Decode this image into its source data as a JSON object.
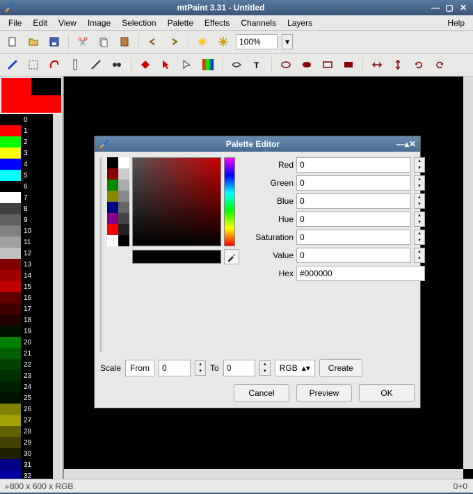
{
  "window": {
    "title": "mtPaint 3.31 - Untitled"
  },
  "menu": {
    "file": "File",
    "edit": "Edit",
    "view": "View",
    "image": "Image",
    "selection": "Selection",
    "palette": "Palette",
    "effects": "Effects",
    "channels": "Channels",
    "layers": "Layers",
    "help": "Help"
  },
  "toolbar": {
    "zoom": "100%"
  },
  "status": {
    "left": "800 x 600 x RGB",
    "right": "0+0"
  },
  "palette_left": [
    {
      "i": 0,
      "c": "#000000"
    },
    {
      "i": 1,
      "c": "#ff0000"
    },
    {
      "i": 2,
      "c": "#00ff00"
    },
    {
      "i": 3,
      "c": "#ffff00"
    },
    {
      "i": 4,
      "c": "#0000ff"
    },
    {
      "i": 5,
      "c": "#00ffff"
    },
    {
      "i": 6,
      "c": "#000000"
    },
    {
      "i": 7,
      "c": "#ffffff"
    },
    {
      "i": 8,
      "c": "#404040"
    },
    {
      "i": 9,
      "c": "#606060"
    },
    {
      "i": 10,
      "c": "#808080"
    },
    {
      "i": 11,
      "c": "#a0a0a0"
    },
    {
      "i": 12,
      "c": "#c0c0c0"
    },
    {
      "i": 13,
      "c": "#800000"
    },
    {
      "i": 14,
      "c": "#a00000"
    },
    {
      "i": 15,
      "c": "#c00000"
    },
    {
      "i": 16,
      "c": "#600000"
    },
    {
      "i": 17,
      "c": "#400000"
    },
    {
      "i": 18,
      "c": "#200000"
    },
    {
      "i": 19,
      "c": "#001000"
    },
    {
      "i": 20,
      "c": "#008000"
    },
    {
      "i": 21,
      "c": "#006000"
    },
    {
      "i": 22,
      "c": "#004000"
    },
    {
      "i": 23,
      "c": "#003000"
    },
    {
      "i": 24,
      "c": "#002000"
    },
    {
      "i": 25,
      "c": "#001000"
    },
    {
      "i": 26,
      "c": "#808000"
    },
    {
      "i": 27,
      "c": "#a0a000"
    },
    {
      "i": 28,
      "c": "#606000"
    },
    {
      "i": 29,
      "c": "#404000"
    },
    {
      "i": 30,
      "c": "#202000"
    },
    {
      "i": 31,
      "c": "#000080"
    },
    {
      "i": 32,
      "c": "#0000a0"
    }
  ],
  "dialog": {
    "title": "Palette Editor",
    "palette": [
      {
        "i": 0,
        "c": "#000000"
      },
      {
        "i": 1,
        "c": "#ff0000"
      },
      {
        "i": 2,
        "c": "#00ff00"
      },
      {
        "i": 3,
        "c": "#ffff00"
      },
      {
        "i": 4,
        "c": "#0000ff"
      },
      {
        "i": 5,
        "c": "#ff00ff"
      },
      {
        "i": 6,
        "c": "#00ffff"
      },
      {
        "i": 7,
        "c": "#ffffff"
      },
      {
        "i": 8,
        "c": "#c0c0c0"
      },
      {
        "i": 9,
        "c": "#a0a0a0"
      },
      {
        "i": 10,
        "c": "#808080"
      }
    ],
    "selected": 0,
    "fields": {
      "red": {
        "label": "Red",
        "value": "0"
      },
      "green": {
        "label": "Green",
        "value": "0"
      },
      "blue": {
        "label": "Blue",
        "value": "0"
      },
      "hue": {
        "label": "Hue",
        "value": "0"
      },
      "saturation": {
        "label": "Saturation",
        "value": "0"
      },
      "val": {
        "label": "Value",
        "value": "0"
      },
      "hex": {
        "label": "Hex",
        "value": "#000000"
      }
    },
    "scale": {
      "label": "Scale",
      "from_label": "From",
      "from": "0",
      "to_label": "To",
      "to": "0",
      "mode": "RGB",
      "create": "Create"
    },
    "buttons": {
      "cancel": "Cancel",
      "preview": "Preview",
      "ok": "OK"
    }
  }
}
